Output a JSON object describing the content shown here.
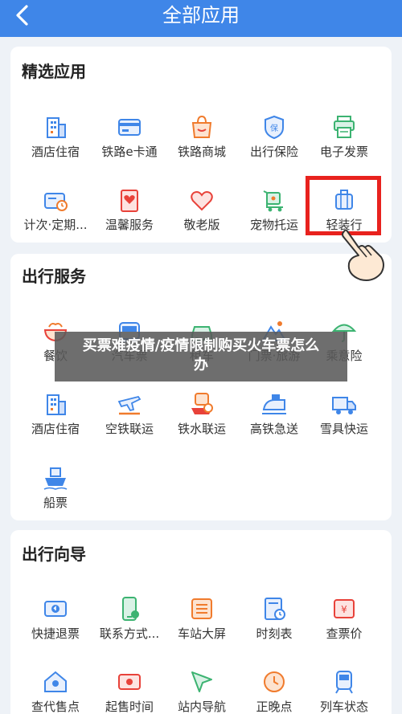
{
  "header": {
    "title": "全部应用"
  },
  "colors": {
    "header_bg": "#3f86e8",
    "icon_blue": "#3f86e8",
    "icon_orange": "#f07b2d",
    "icon_red": "#e8423a",
    "icon_green": "#3cb371",
    "highlight": "#e8221e"
  },
  "sections": [
    {
      "title": "精选应用",
      "items": [
        {
          "label": "酒店住宿",
          "icon": "hotel-icon"
        },
        {
          "label": "铁路e卡通",
          "icon": "rail-card-icon"
        },
        {
          "label": "铁路商城",
          "icon": "shop-icon"
        },
        {
          "label": "出行保险",
          "icon": "insurance-shield-icon"
        },
        {
          "label": "电子发票",
          "icon": "invoice-printer-icon"
        },
        {
          "label": "计次·定期...",
          "icon": "pass-card-icon"
        },
        {
          "label": "温馨服务",
          "icon": "service-heart-icon"
        },
        {
          "label": "敬老版",
          "icon": "heart-icon"
        },
        {
          "label": "宠物托运",
          "icon": "pet-cart-icon"
        },
        {
          "label": "轻装行",
          "icon": "luggage-icon"
        }
      ]
    },
    {
      "title": "出行服务",
      "items": [
        {
          "label": "餐饮",
          "icon": "food-bowl-icon"
        },
        {
          "label": "汽车票",
          "icon": "bus-icon"
        },
        {
          "label": "租车",
          "icon": "car-icon"
        },
        {
          "label": "门票·旅游",
          "icon": "mountain-icon"
        },
        {
          "label": "乘意险",
          "icon": "umbrella-icon"
        },
        {
          "label": "酒店住宿",
          "icon": "hotel-icon"
        },
        {
          "label": "空铁联运",
          "icon": "plane-train-icon"
        },
        {
          "label": "铁水联运",
          "icon": "ship-train-icon"
        },
        {
          "label": "高铁急送",
          "icon": "express-train-icon"
        },
        {
          "label": "雪具快运",
          "icon": "truck-icon"
        },
        {
          "label": "船票",
          "icon": "ship-icon"
        }
      ]
    },
    {
      "title": "出行向导",
      "items": [
        {
          "label": "快捷退票",
          "icon": "refund-ticket-icon"
        },
        {
          "label": "联系方式...",
          "icon": "contact-phone-icon"
        },
        {
          "label": "车站大屏",
          "icon": "station-screen-icon"
        },
        {
          "label": "时刻表",
          "icon": "timetable-icon"
        },
        {
          "label": "查票价",
          "icon": "price-ticket-icon"
        },
        {
          "label": "查代售点",
          "icon": "agency-location-icon"
        },
        {
          "label": "起售时间",
          "icon": "sale-time-icon"
        },
        {
          "label": "站内导航",
          "icon": "navigation-icon"
        },
        {
          "label": "正晚点",
          "icon": "clock-icon"
        },
        {
          "label": "列车状态",
          "icon": "train-status-icon"
        }
      ]
    }
  ],
  "overlay": {
    "text": "买票难疫情/疫情限制购买火车票怎么办"
  }
}
